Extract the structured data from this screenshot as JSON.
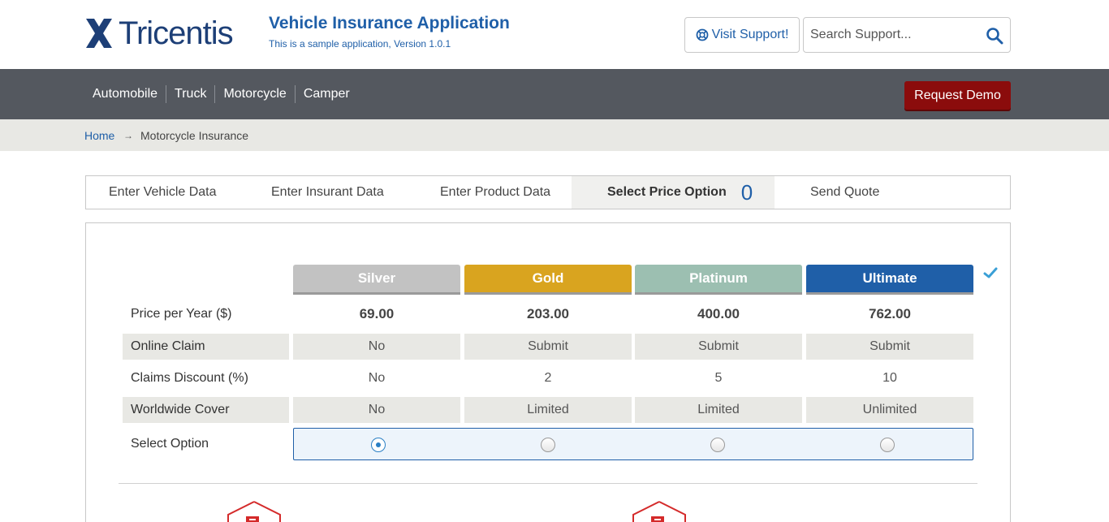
{
  "header": {
    "logo_text": "Tricentis",
    "app_title": "Vehicle Insurance Application",
    "app_subtitle": "This is a sample application, Version 1.0.1",
    "support_label": "Visit Support!",
    "search_placeholder": "Search Support..."
  },
  "nav": {
    "items": [
      {
        "label": "Automobile"
      },
      {
        "label": "Truck"
      },
      {
        "label": "Motorcycle"
      },
      {
        "label": "Camper"
      }
    ],
    "demo_label": "Request Demo"
  },
  "breadcrumb": {
    "home": "Home",
    "arrow": "→",
    "current": "Motorcycle Insurance"
  },
  "steps": [
    {
      "label": "Enter Vehicle Data"
    },
    {
      "label": "Enter Insurant Data"
    },
    {
      "label": "Enter Product Data"
    },
    {
      "label": "Select Price Option",
      "count": "0",
      "active": true
    },
    {
      "label": "Send Quote"
    }
  ],
  "plans": [
    {
      "name": "Silver",
      "color": "#c2c2c2"
    },
    {
      "name": "Gold",
      "color": "#d9a41f"
    },
    {
      "name": "Platinum",
      "color": "#9cbfb1"
    },
    {
      "name": "Ultimate",
      "color": "#1f5fa8"
    }
  ],
  "rows": {
    "price": {
      "label": "Price per Year ($)",
      "values": [
        "69.00",
        "203.00",
        "400.00",
        "762.00"
      ]
    },
    "online_claim": {
      "label": "Online Claim",
      "values": [
        "No",
        "Submit",
        "Submit",
        "Submit"
      ]
    },
    "claims_discount": {
      "label": "Claims Discount (%)",
      "values": [
        "No",
        "2",
        "5",
        "10"
      ]
    },
    "worldwide_cover": {
      "label": "Worldwide Cover",
      "values": [
        "No",
        "Limited",
        "Limited",
        "Unlimited"
      ]
    },
    "select_option": {
      "label": "Select Option",
      "selected_index": 0
    }
  },
  "colors": {
    "brand_blue": "#1f5fa8",
    "nav_bg": "#54585f",
    "demo_red": "#8b0c0c"
  }
}
